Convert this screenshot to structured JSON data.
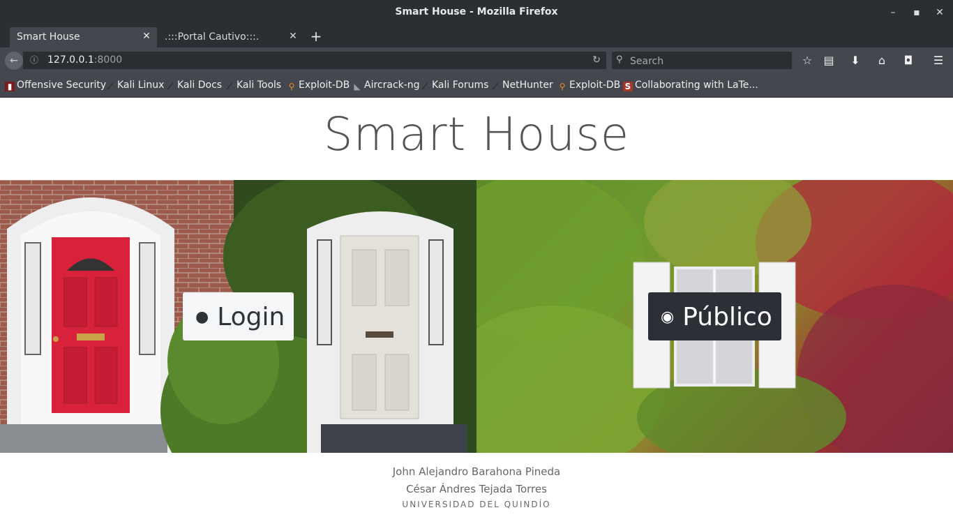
{
  "window": {
    "title": "Smart House - Mozilla Firefox"
  },
  "tabs": [
    {
      "label": "Smart House",
      "active": true
    },
    {
      "label": ".:::Portal Cautivo:::.",
      "active": false
    }
  ],
  "navbar": {
    "url_host": "127.0.0.1",
    "url_port": ":8000",
    "search_placeholder": "Search"
  },
  "bookmarks": [
    {
      "label": "Offensive Security",
      "icon": "offsec-icon"
    },
    {
      "label": "Kali Linux",
      "icon": "kali-icon"
    },
    {
      "label": "Kali Docs",
      "icon": "kali-icon"
    },
    {
      "label": "Kali Tools",
      "icon": "kali-icon"
    },
    {
      "label": "Exploit-DB",
      "icon": "exploitdb-icon"
    },
    {
      "label": "Aircrack-ng",
      "icon": "aircrack-icon"
    },
    {
      "label": "Kali Forums",
      "icon": "kali-icon"
    },
    {
      "label": "NetHunter",
      "icon": "kali-icon"
    },
    {
      "label": "Exploit-DB",
      "icon": "exploitdb-icon"
    },
    {
      "label": "Collaborating with LaTe...",
      "icon": "sharelatex-icon"
    }
  ],
  "page": {
    "title": "Smart House",
    "login_label": "Login",
    "public_label": "Público",
    "authors": [
      "John Alejandro Barahona Pineda",
      "César Ándres Tejada Torres"
    ],
    "university": "UNIVERSIDAD DEL QUINDÍO"
  },
  "colors": {
    "chrome_dark": "#2b2e33",
    "chrome_mid": "#44484e",
    "button_light": "#f5f6f7",
    "button_dark": "#2c2f35",
    "door_red": "#d8213b"
  }
}
